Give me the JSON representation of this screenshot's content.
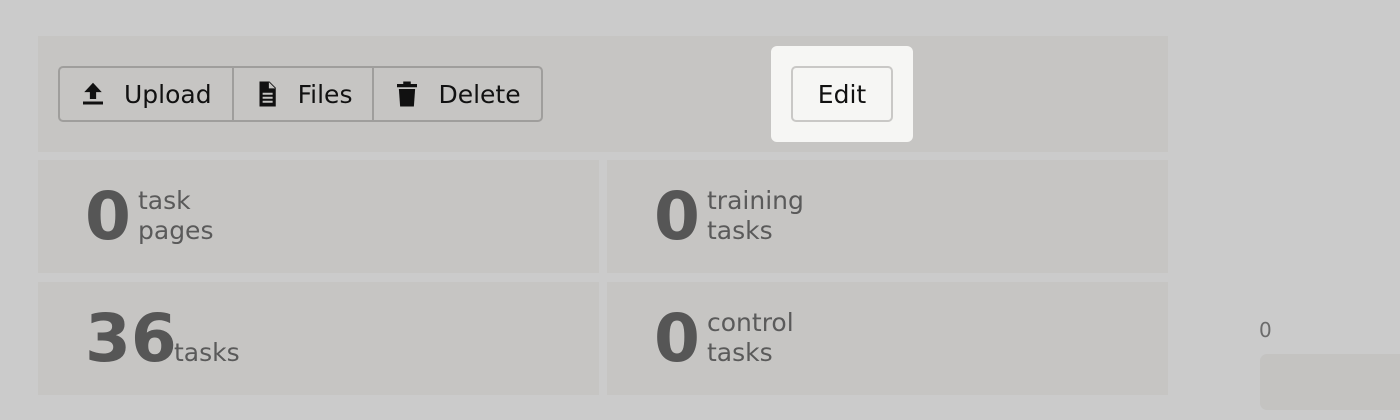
{
  "toolbar": {
    "buttons": [
      {
        "label": "Upload",
        "icon": "upload-icon"
      },
      {
        "label": "Files",
        "icon": "file-icon"
      },
      {
        "label": "Delete",
        "icon": "trash-icon"
      }
    ],
    "edit_label": "Edit"
  },
  "stats": [
    {
      "value": "0",
      "label": "task\npages"
    },
    {
      "value": "0",
      "label": "training\ntasks"
    },
    {
      "value": "36",
      "label": "tasks"
    },
    {
      "value": "0",
      "label": "control\ntasks"
    }
  ],
  "side": {
    "value": "0"
  },
  "colors": {
    "background": "#cbcbcb",
    "panel": "#c6c5c3",
    "highlight": "#f6f6f4",
    "number": "#565656"
  }
}
